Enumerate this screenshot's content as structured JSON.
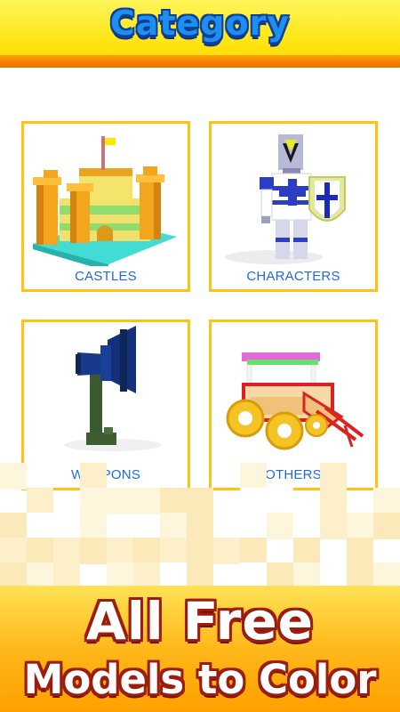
{
  "header": {
    "title": "Category"
  },
  "categories": [
    {
      "label": "CASTLES",
      "icon": "castle-icon"
    },
    {
      "label": "CHARACTERS",
      "icon": "knight-icon"
    },
    {
      "label": "WEAPONS",
      "icon": "axe-icon"
    },
    {
      "label": "OTHERS",
      "icon": "carriage-icon"
    }
  ],
  "promo": {
    "line1": "All Free",
    "line2": "Models to Color"
  },
  "colors": {
    "header_yellow": "#ffe81c",
    "header_band_orange": "#ff9d00",
    "title_blue": "#1e8ff0",
    "card_border": "#ffc315",
    "label_blue": "#1f6bd6",
    "promo_outline": "#9b1d0e"
  }
}
